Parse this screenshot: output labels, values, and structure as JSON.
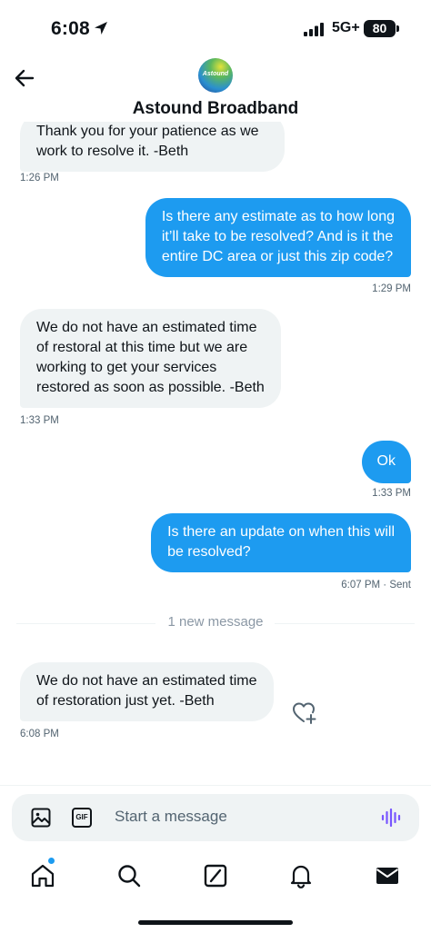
{
  "status_bar": {
    "time": "6:08",
    "network": "5G+",
    "battery": "80"
  },
  "header": {
    "title": "Astound Broadband",
    "avatar_text": "Astound"
  },
  "messages": [
    {
      "dir": "in",
      "lines": [
        "Thank you for your patience as we",
        "work to resolve it. -Beth"
      ],
      "time": "1:26 PM"
    },
    {
      "dir": "out",
      "lines": [
        "Is there any estimate as to how long",
        "it’ll take to be resolved? And is it the",
        "entire DC area or just this zip code?"
      ],
      "time": "1:29 PM"
    },
    {
      "dir": "in",
      "lines": [
        "We do not have an estimated time",
        "of restoral at this time but we are",
        "working to get your services",
        "restored as soon as possible. -Beth"
      ],
      "time": "1:33 PM"
    },
    {
      "dir": "out",
      "lines": [
        "Ok"
      ],
      "time": "1:33 PM"
    },
    {
      "dir": "out",
      "lines": [
        "Is there an update on when this will",
        "be resolved?"
      ],
      "time": "6:07 PM · Sent"
    },
    {
      "dir": "in",
      "lines": [
        "We do not have an estimated time",
        "of restoration just yet. -Beth"
      ],
      "time": "6:08 PM"
    }
  ],
  "divider": {
    "text": "1 new message"
  },
  "composer": {
    "placeholder": "Start a message",
    "gif_label": "GIF"
  },
  "tabbar": {
    "items": [
      "home-icon",
      "search-icon",
      "grok-icon",
      "notifications-icon",
      "messages-icon"
    ]
  },
  "colors": {
    "accent": "#1d9bf0",
    "incoming_bubble": "#eff3f4",
    "voice_icon": "#7856ff"
  }
}
